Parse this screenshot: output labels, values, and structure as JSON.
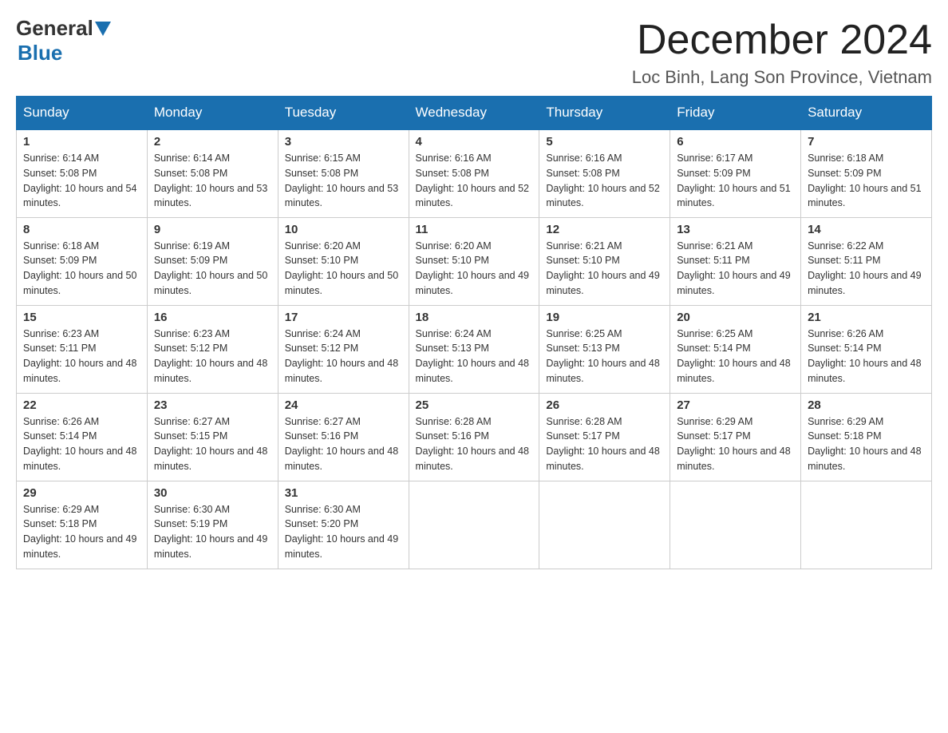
{
  "logo": {
    "general": "General",
    "blue": "Blue"
  },
  "header": {
    "month_year": "December 2024",
    "location": "Loc Binh, Lang Son Province, Vietnam"
  },
  "days_of_week": [
    "Sunday",
    "Monday",
    "Tuesday",
    "Wednesday",
    "Thursday",
    "Friday",
    "Saturday"
  ],
  "weeks": [
    [
      {
        "day": "1",
        "sunrise": "6:14 AM",
        "sunset": "5:08 PM",
        "daylight": "10 hours and 54 minutes."
      },
      {
        "day": "2",
        "sunrise": "6:14 AM",
        "sunset": "5:08 PM",
        "daylight": "10 hours and 53 minutes."
      },
      {
        "day": "3",
        "sunrise": "6:15 AM",
        "sunset": "5:08 PM",
        "daylight": "10 hours and 53 minutes."
      },
      {
        "day": "4",
        "sunrise": "6:16 AM",
        "sunset": "5:08 PM",
        "daylight": "10 hours and 52 minutes."
      },
      {
        "day": "5",
        "sunrise": "6:16 AM",
        "sunset": "5:08 PM",
        "daylight": "10 hours and 52 minutes."
      },
      {
        "day": "6",
        "sunrise": "6:17 AM",
        "sunset": "5:09 PM",
        "daylight": "10 hours and 51 minutes."
      },
      {
        "day": "7",
        "sunrise": "6:18 AM",
        "sunset": "5:09 PM",
        "daylight": "10 hours and 51 minutes."
      }
    ],
    [
      {
        "day": "8",
        "sunrise": "6:18 AM",
        "sunset": "5:09 PM",
        "daylight": "10 hours and 50 minutes."
      },
      {
        "day": "9",
        "sunrise": "6:19 AM",
        "sunset": "5:09 PM",
        "daylight": "10 hours and 50 minutes."
      },
      {
        "day": "10",
        "sunrise": "6:20 AM",
        "sunset": "5:10 PM",
        "daylight": "10 hours and 50 minutes."
      },
      {
        "day": "11",
        "sunrise": "6:20 AM",
        "sunset": "5:10 PM",
        "daylight": "10 hours and 49 minutes."
      },
      {
        "day": "12",
        "sunrise": "6:21 AM",
        "sunset": "5:10 PM",
        "daylight": "10 hours and 49 minutes."
      },
      {
        "day": "13",
        "sunrise": "6:21 AM",
        "sunset": "5:11 PM",
        "daylight": "10 hours and 49 minutes."
      },
      {
        "day": "14",
        "sunrise": "6:22 AM",
        "sunset": "5:11 PM",
        "daylight": "10 hours and 49 minutes."
      }
    ],
    [
      {
        "day": "15",
        "sunrise": "6:23 AM",
        "sunset": "5:11 PM",
        "daylight": "10 hours and 48 minutes."
      },
      {
        "day": "16",
        "sunrise": "6:23 AM",
        "sunset": "5:12 PM",
        "daylight": "10 hours and 48 minutes."
      },
      {
        "day": "17",
        "sunrise": "6:24 AM",
        "sunset": "5:12 PM",
        "daylight": "10 hours and 48 minutes."
      },
      {
        "day": "18",
        "sunrise": "6:24 AM",
        "sunset": "5:13 PM",
        "daylight": "10 hours and 48 minutes."
      },
      {
        "day": "19",
        "sunrise": "6:25 AM",
        "sunset": "5:13 PM",
        "daylight": "10 hours and 48 minutes."
      },
      {
        "day": "20",
        "sunrise": "6:25 AM",
        "sunset": "5:14 PM",
        "daylight": "10 hours and 48 minutes."
      },
      {
        "day": "21",
        "sunrise": "6:26 AM",
        "sunset": "5:14 PM",
        "daylight": "10 hours and 48 minutes."
      }
    ],
    [
      {
        "day": "22",
        "sunrise": "6:26 AM",
        "sunset": "5:14 PM",
        "daylight": "10 hours and 48 minutes."
      },
      {
        "day": "23",
        "sunrise": "6:27 AM",
        "sunset": "5:15 PM",
        "daylight": "10 hours and 48 minutes."
      },
      {
        "day": "24",
        "sunrise": "6:27 AM",
        "sunset": "5:16 PM",
        "daylight": "10 hours and 48 minutes."
      },
      {
        "day": "25",
        "sunrise": "6:28 AM",
        "sunset": "5:16 PM",
        "daylight": "10 hours and 48 minutes."
      },
      {
        "day": "26",
        "sunrise": "6:28 AM",
        "sunset": "5:17 PM",
        "daylight": "10 hours and 48 minutes."
      },
      {
        "day": "27",
        "sunrise": "6:29 AM",
        "sunset": "5:17 PM",
        "daylight": "10 hours and 48 minutes."
      },
      {
        "day": "28",
        "sunrise": "6:29 AM",
        "sunset": "5:18 PM",
        "daylight": "10 hours and 48 minutes."
      }
    ],
    [
      {
        "day": "29",
        "sunrise": "6:29 AM",
        "sunset": "5:18 PM",
        "daylight": "10 hours and 49 minutes."
      },
      {
        "day": "30",
        "sunrise": "6:30 AM",
        "sunset": "5:19 PM",
        "daylight": "10 hours and 49 minutes."
      },
      {
        "day": "31",
        "sunrise": "6:30 AM",
        "sunset": "5:20 PM",
        "daylight": "10 hours and 49 minutes."
      },
      null,
      null,
      null,
      null
    ]
  ]
}
